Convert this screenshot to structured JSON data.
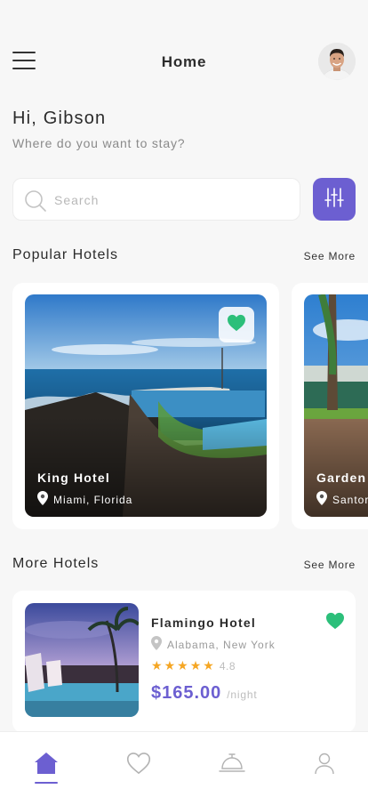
{
  "header": {
    "title": "Home"
  },
  "greeting": {
    "title": "Hi, Gibson",
    "subtitle": "Where do you want to stay?"
  },
  "search": {
    "placeholder": "Search",
    "value": ""
  },
  "popular": {
    "title": "Popular Hotels",
    "see_more": "See More",
    "hotels": [
      {
        "name": "King Hotel",
        "location": "Miami, Florida",
        "favorite": true
      },
      {
        "name": "Garden",
        "location": "Santor",
        "favorite": false
      }
    ]
  },
  "more": {
    "title": "More Hotels",
    "see_more": "See More",
    "hotels": [
      {
        "name": "Flamingo Hotel",
        "location": "Alabama, New York",
        "stars": 5,
        "rating": "4.8",
        "price": "$165.00",
        "per": "/night",
        "favorite": true
      }
    ]
  },
  "tabs": [
    {
      "icon": "home-icon",
      "active": true
    },
    {
      "icon": "heart-icon",
      "active": false
    },
    {
      "icon": "service-bell-icon",
      "active": false
    },
    {
      "icon": "profile-icon",
      "active": false
    }
  ],
  "colors": {
    "accent": "#6c5fd1",
    "favorite": "#2cbf7a",
    "star": "#f5a623"
  }
}
